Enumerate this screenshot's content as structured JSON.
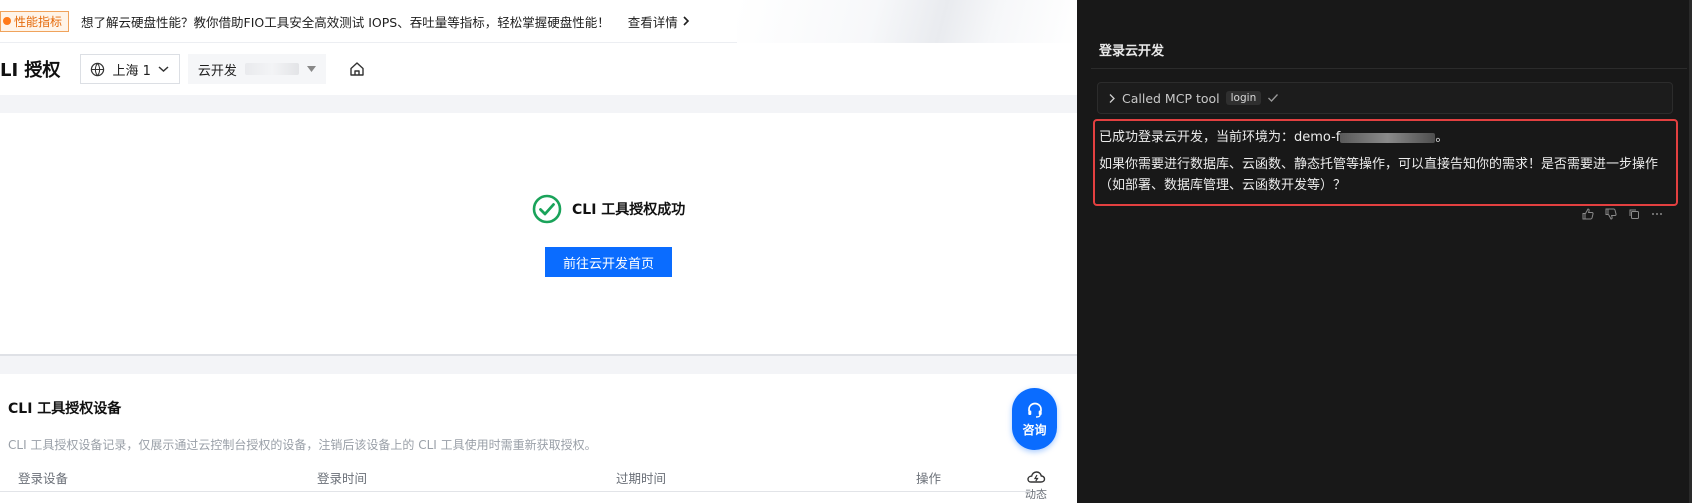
{
  "banner": {
    "tag": "性能指标",
    "text": "想了解云硬盘性能？教你借助FIO工具安全高效测试 IOPS、吞吐量等指标，轻松掌握硬盘性能！",
    "link": "查看详情"
  },
  "header": {
    "title": "LI 授权",
    "region": "上海 1",
    "env_label": "云开发"
  },
  "success": {
    "message": "CLI 工具授权成功",
    "button": "前往云开发首页"
  },
  "devices": {
    "title": "CLI 工具授权设备",
    "description": "CLI 工具授权设备记录，仅展示通过云控制台授权的设备，注销后该设备上的 CLI 工具使用时需重新获取授权。",
    "columns": [
      "登录设备",
      "登录时间",
      "过期时间",
      "操作"
    ]
  },
  "float": {
    "consult": "咨询",
    "dynamic": "动态"
  },
  "chat": {
    "title": "登录云开发",
    "tool_text": "Called MCP tool",
    "tool_name": "login",
    "line1_prefix": "已成功登录云开发，当前环境为：demo-f",
    "line1_suffix": "。",
    "line2": "如果你需要进行数据库、云函数、静态托管等操作，可以直接告知你的需求！是否需要进一步操作",
    "line3": "（如部署、数据库管理、云函数开发等）？"
  },
  "colors": {
    "primary": "#0a6cff",
    "success": "#1aa35a",
    "highlight": "#e34040",
    "chat_bg": "#181818"
  },
  "icons": [
    "globe-icon",
    "chevron-down-icon",
    "caret-down-icon",
    "home-icon",
    "check-circle-icon",
    "headset-icon",
    "cloud-icon",
    "chevron-right-icon",
    "check-icon",
    "thumbs-up-icon",
    "thumbs-down-icon",
    "copy-icon",
    "more-icon"
  ]
}
